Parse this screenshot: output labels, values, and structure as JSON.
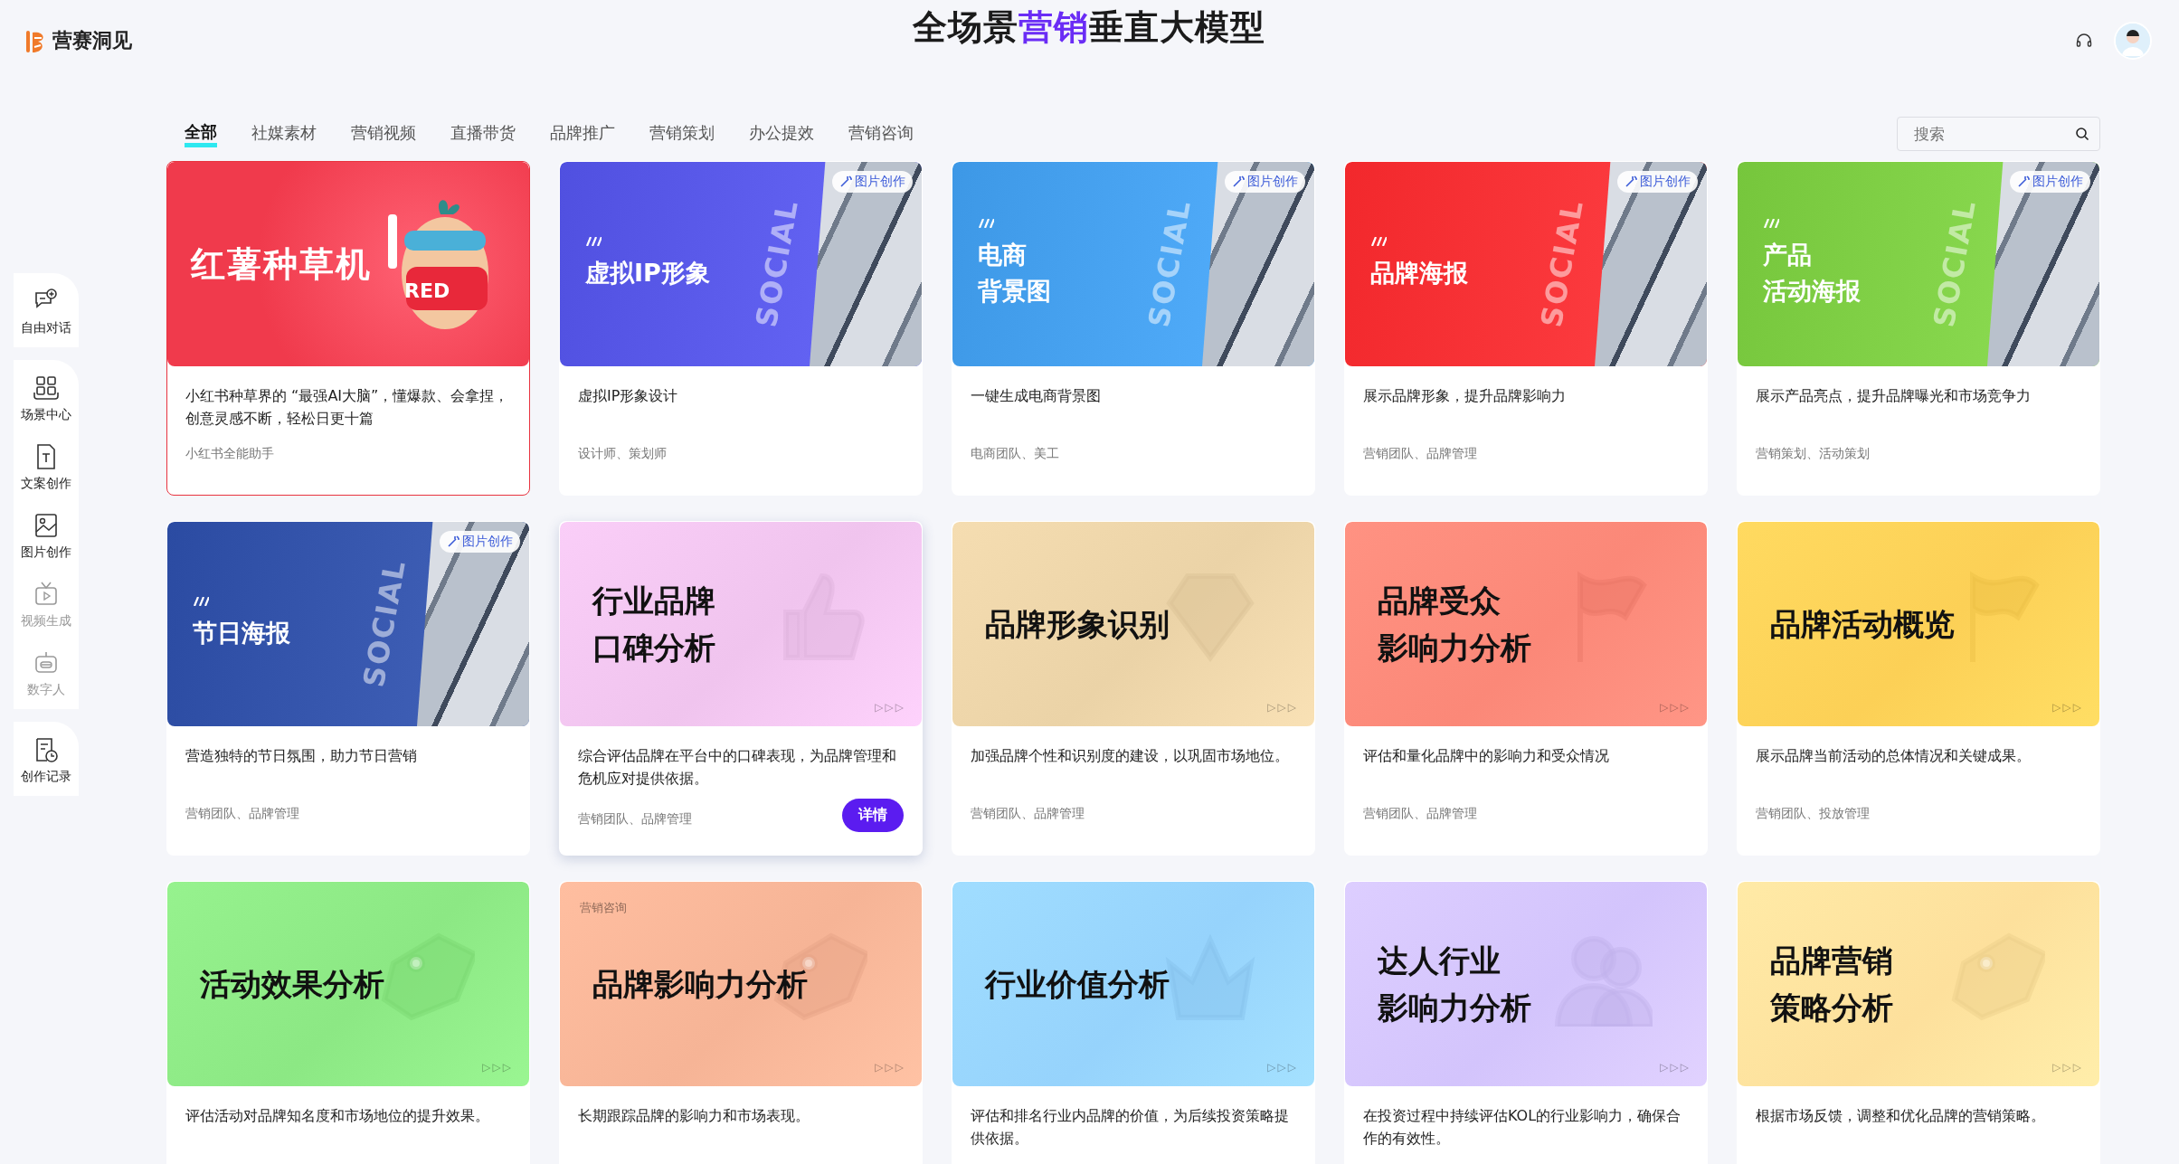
{
  "header": {
    "logo_text": "营赛洞见",
    "title_parts": [
      {
        "text": "全场景",
        "highlight": false
      },
      {
        "text": "营销",
        "highlight": true
      },
      {
        "text": "垂直大模型",
        "highlight": false
      }
    ]
  },
  "sidebar": {
    "groups": [
      {
        "items": [
          {
            "label": "自由对话",
            "disabled": false
          }
        ]
      },
      {
        "items": [
          {
            "label": "场景中心",
            "disabled": false
          },
          {
            "label": "文案创作",
            "disabled": false
          },
          {
            "label": "图片创作",
            "disabled": false
          },
          {
            "label": "视频生成",
            "disabled": true
          },
          {
            "label": "数字人",
            "disabled": true
          }
        ]
      },
      {
        "items": [
          {
            "label": "创作记录",
            "disabled": false
          }
        ]
      }
    ]
  },
  "tabs": [
    {
      "label": "全部",
      "selected": true
    },
    {
      "label": "社媒素材",
      "selected": false
    },
    {
      "label": "营销视频",
      "selected": false
    },
    {
      "label": "直播带货",
      "selected": false
    },
    {
      "label": "品牌推广",
      "selected": false
    },
    {
      "label": "营销策划",
      "selected": false
    },
    {
      "label": "办公提效",
      "selected": false
    },
    {
      "label": "营销咨询",
      "selected": false
    }
  ],
  "search": {
    "placeholder": "搜索"
  },
  "cards": [
    {
      "kind": "mascot",
      "title": "红薯种草机",
      "mascot_label": "RED",
      "color": "#f03a4c",
      "selected": true,
      "description": "小红书种草界的 “最强AI大脑”，懂爆款、会拿捏，创意灵感不断，轻松日更十篇",
      "tags": "小红书全能助手"
    },
    {
      "kind": "collage",
      "title": "虚拟IP形象",
      "badge": "图片创作",
      "deco_text": "SOCIAL",
      "color": "#5050e0",
      "selected": false,
      "description": "虚拟IP形象设计",
      "tags": "设计师、策划师"
    },
    {
      "kind": "collage",
      "title_lines": [
        "电商",
        "背景图"
      ],
      "badge": "图片创作",
      "deco_text": "SOCIAL",
      "color": "#3d98e6",
      "selected": false,
      "description": "一键生成电商背景图",
      "tags": "电商团队、美工"
    },
    {
      "kind": "collage",
      "title": "品牌海报",
      "badge": "图片创作",
      "deco_text": "SOCIAL",
      "color": "#f2282c",
      "selected": false,
      "description": "展示品牌形象，提升品牌影响力",
      "tags": "营销团队、品牌管理"
    },
    {
      "kind": "collage",
      "title_lines": [
        "产品",
        "活动海报"
      ],
      "badge": "图片创作",
      "deco_text": "SOCIAL",
      "color": "#76c63c",
      "selected": false,
      "description": "展示产品亮点，提升品牌曝光和市场竞争力",
      "tags": "营销策划、活动策划"
    },
    {
      "kind": "collage",
      "title": "节日海报",
      "badge": "图片创作",
      "deco_text": "SOCIAL",
      "color": "#2b4ba2",
      "selected": false,
      "description": "营造独特的节日氛围，助力节日营销",
      "tags": "营销团队、品牌管理"
    },
    {
      "kind": "plain",
      "title_lines": [
        "行业品牌",
        "口碑分析"
      ],
      "arrows": "▷▷▷",
      "action": "详情",
      "color": "#f0c4ee",
      "selected": false,
      "description": "综合评估品牌在平台中的口碑表现，为品牌管理和危机应对提供依据。",
      "tags": "营销团队、品牌管理"
    },
    {
      "kind": "plain",
      "title": "品牌形象识别",
      "arrows": "▷▷▷",
      "color": "#ebd3a7",
      "selected": false,
      "description": "加强品牌个性和识别度的建设，以巩固市场地位。",
      "tags": "营销团队、品牌管理"
    },
    {
      "kind": "plain",
      "title_lines": [
        "品牌受众",
        "影响力分析"
      ],
      "arrows": "▷▷▷",
      "color": "#fb8878",
      "selected": false,
      "description": "评估和量化品牌中的影响力和受众情况",
      "tags": "营销团队、品牌管理"
    },
    {
      "kind": "plain",
      "title": "品牌活动概览",
      "arrows": "▷▷▷",
      "color": "#fcd056",
      "selected": false,
      "description": "展示品牌当前活动的总体情况和关键成果。",
      "tags": "营销团队、投放管理"
    },
    {
      "kind": "plain",
      "title": "活动效果分析",
      "arrows": "▷▷▷",
      "color": "#8ce884",
      "selected": false,
      "description": "评估活动对品牌知名度和市场地位的提升效果。"
    },
    {
      "kind": "plain",
      "title": "品牌影响力分析",
      "tag": "营销咨询",
      "arrows": "▷▷▷",
      "color": "#f6b496",
      "selected": false,
      "description": "长期跟踪品牌的影响力和市场表现。"
    },
    {
      "kind": "plain",
      "title": "行业价值分析",
      "arrows": "▷▷▷",
      "color": "#96d3fc",
      "selected": false,
      "description": "评估和排名行业内品牌的价值，为后续投资策略提供依据。"
    },
    {
      "kind": "plain",
      "title_lines": [
        "达人行业",
        "影响力分析"
      ],
      "arrows": "▷▷▷",
      "color": "#d3c4fc",
      "selected": false,
      "description": "在投资过程中持续评估KOL的行业影响力，确保合作的有效性。"
    },
    {
      "kind": "plain",
      "title_lines": [
        "品牌营销",
        "策略分析"
      ],
      "arrows": "▷▷▷",
      "color": "#fde09c",
      "selected": false,
      "description": "根据市场反馈，调整和优化品牌的营销策略。"
    }
  ]
}
